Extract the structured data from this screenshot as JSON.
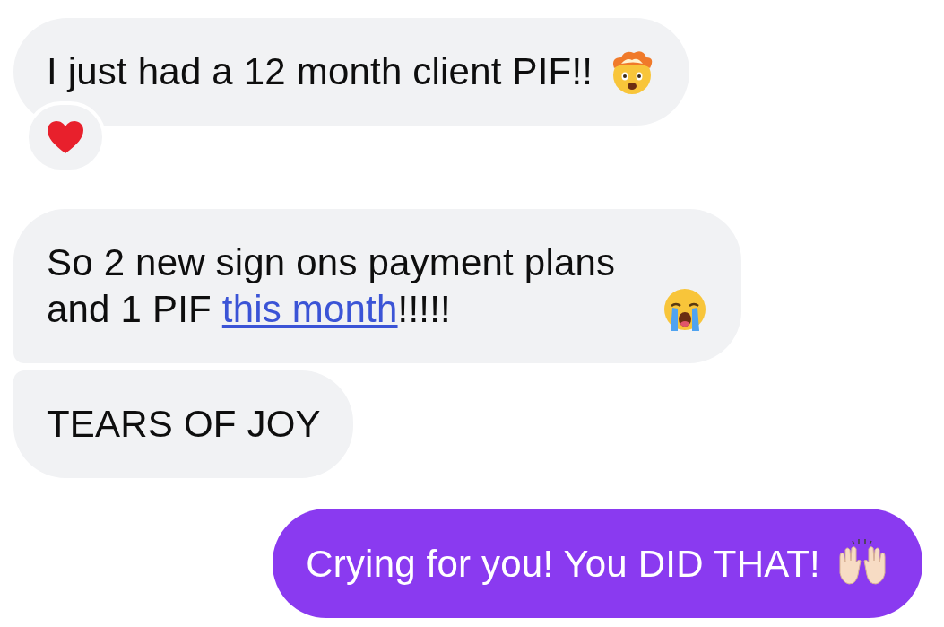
{
  "messages": [
    {
      "kind": "received",
      "parts": [
        {
          "text": "I just had a 12 month client PIF!!",
          "link": false
        }
      ],
      "reacted": true
    },
    {
      "kind": "received",
      "parts": [
        {
          "text": "So 2 new sign ons payment plans and 1 PIF ",
          "link": false
        },
        {
          "text": "this month",
          "link": true
        },
        {
          "text": "!!!!!",
          "link": false
        }
      ],
      "reacted": false
    },
    {
      "kind": "received",
      "parts": [
        {
          "text": "TEARS OF JOY",
          "link": false
        }
      ],
      "reacted": false
    },
    {
      "kind": "sent",
      "parts": [
        {
          "text": "Crying for you! You DID THAT!",
          "link": false
        }
      ],
      "reacted": false
    }
  ]
}
